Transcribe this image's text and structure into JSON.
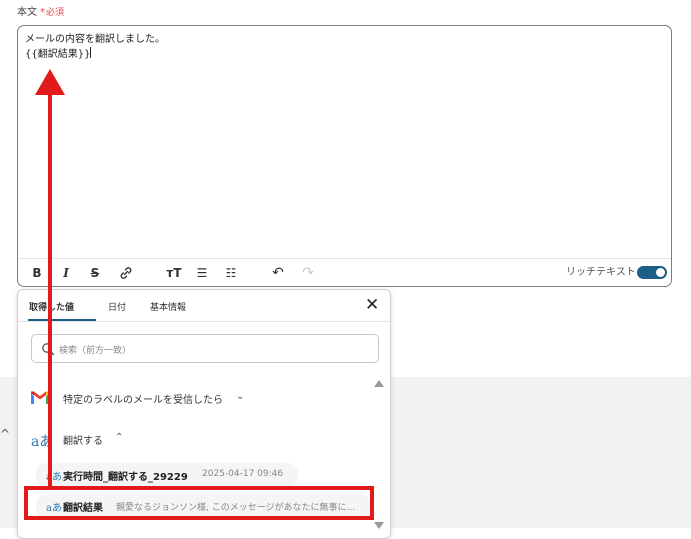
{
  "field": {
    "label": "本文",
    "required_mark": "*",
    "required_text": "必須"
  },
  "editor": {
    "content_lines": [
      "メールの内容を翻訳しました。",
      "{{翻訳結果}}"
    ],
    "toolbar": {
      "bold": "B",
      "italic": "I",
      "strike": "S",
      "link_icon": "link-icon",
      "text_size": "тT",
      "bullet_list": "☰",
      "numbered_list": "☷",
      "undo": "↶",
      "redo": "↷"
    },
    "rich_text_label": "リッチテキスト",
    "rich_text_enabled": true
  },
  "panel": {
    "tabs": [
      {
        "label": "取得した値",
        "active": true
      },
      {
        "label": "日付",
        "active": false
      },
      {
        "label": "基本情報",
        "active": false
      }
    ],
    "close": "✕",
    "search_placeholder": "検索（前方一致）",
    "sources": [
      {
        "icon": "gmail-icon",
        "label": "特定のラベルのメールを受信したら",
        "expanded": false
      },
      {
        "icon": "translate-icon",
        "label": "翻訳する",
        "expanded": true
      }
    ],
    "items": [
      {
        "label": "実行時間_翻訳する_29229",
        "meta": "2025-04-17 09:46"
      },
      {
        "label": "翻訳結果",
        "meta": "親愛なるジョンソン様, このメッセージがあなたに無事に..."
      }
    ]
  },
  "side_caret": "^",
  "colors": {
    "accent": "#1c5e86",
    "required": "#e04b4b",
    "annotation": "#e21a1a"
  }
}
